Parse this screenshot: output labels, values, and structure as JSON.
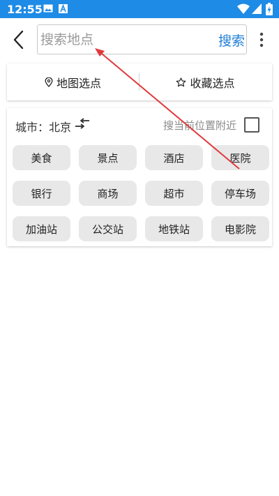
{
  "status_bar": {
    "time": "12:55",
    "icons": [
      "image-icon",
      "a-icon",
      "wifi-icon",
      "signal-icon",
      "battery-charging-icon"
    ],
    "background_color": "#1e8be6"
  },
  "top_bar": {
    "back_icon": "chevron-left-icon",
    "search": {
      "placeholder": "搜索地点",
      "value": ""
    },
    "search_button_label": "搜索",
    "more_icon": "more-vertical-icon",
    "accent_color": "#1e7ed8"
  },
  "pick_modes": {
    "map_pick": {
      "icon": "location-pin-icon",
      "label": "地图选点"
    },
    "favorites": {
      "icon": "star-outline-icon",
      "label": "收藏选点"
    }
  },
  "city_panel": {
    "city_text": "城市：北京",
    "swap_icon": "swap-icon",
    "nearby_label": "搜当前位置附近",
    "nearby_checked": false,
    "categories": [
      "美食",
      "景点",
      "酒店",
      "医院",
      "银行",
      "商场",
      "超市",
      "停车场",
      "加油站",
      "公交站",
      "地铁站",
      "电影院"
    ]
  },
  "annotation": {
    "color": "#e0393e"
  }
}
